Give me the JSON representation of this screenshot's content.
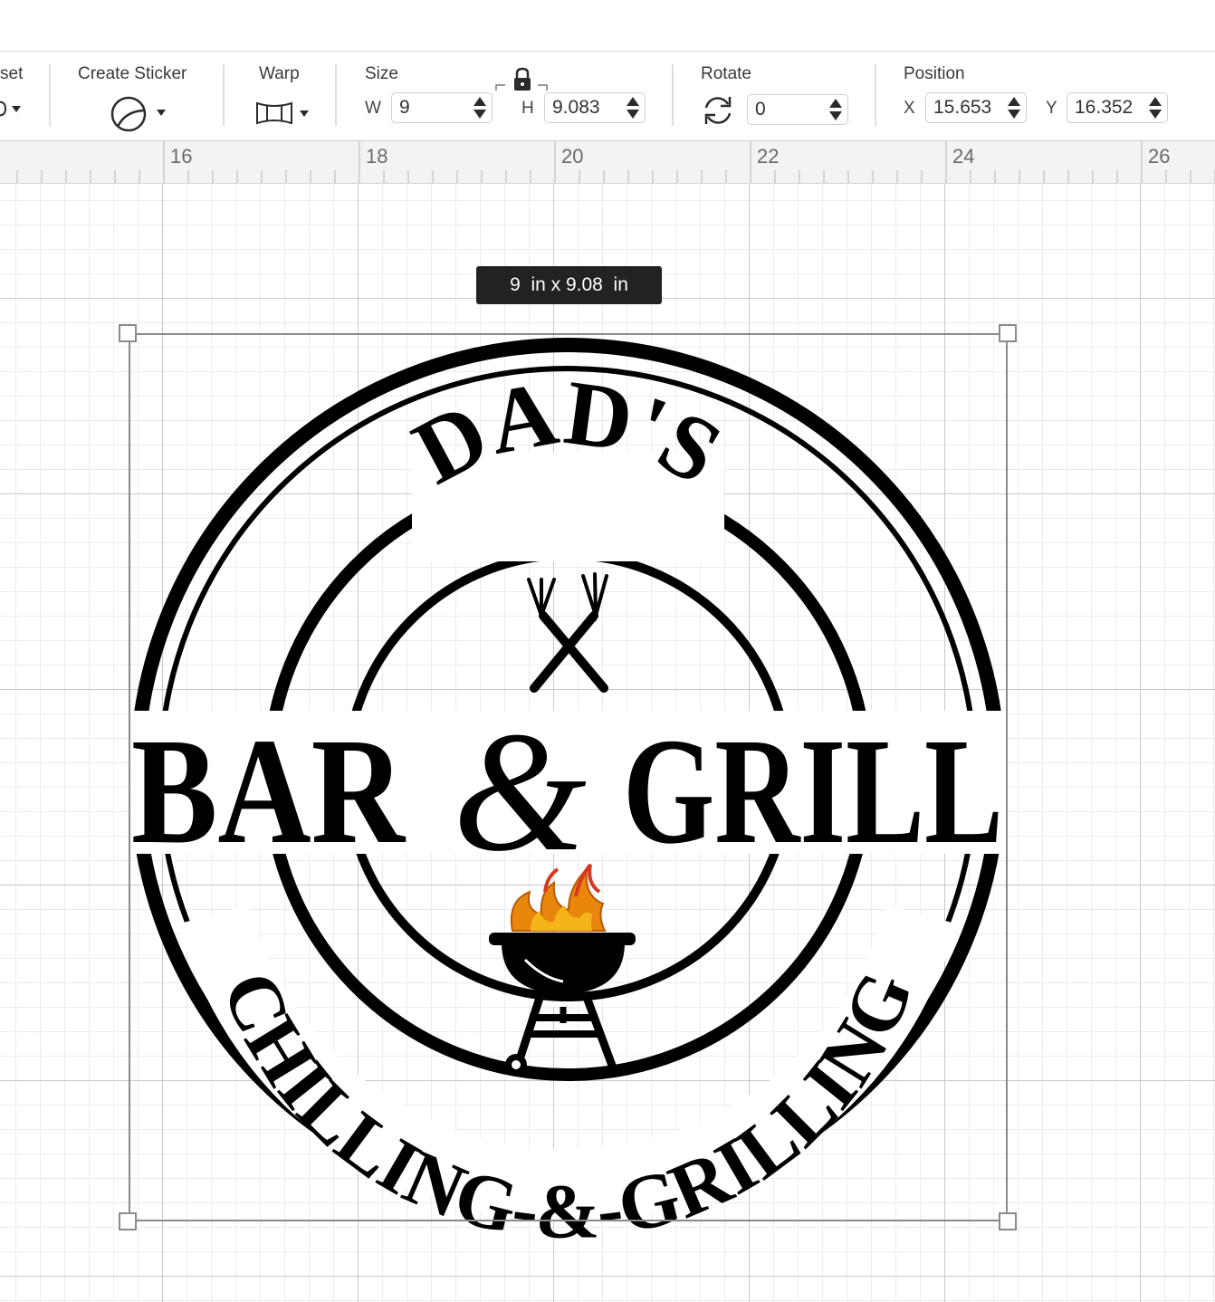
{
  "toolbar": {
    "offset_label": "set",
    "create_sticker_label": "Create Sticker",
    "warp_label": "Warp",
    "size_label": "Size",
    "width_letter": "W",
    "width_value": "9",
    "height_letter": "H",
    "height_value": "9.083",
    "rotate_label": "Rotate",
    "rotate_value": "0",
    "position_label": "Position",
    "x_letter": "X",
    "x_value": "15.653",
    "y_letter": "Y",
    "y_value": "16.352",
    "icons": [
      "offset-icon",
      "sticker-icon",
      "warp-icon",
      "lock-icon",
      "rotate-icon",
      "stepper-icon"
    ]
  },
  "ruler": {
    "ticks": [
      "16",
      "18",
      "20",
      "22",
      "24",
      "26"
    ]
  },
  "canvas": {
    "size_tooltip": "9  in x 9.08  in"
  },
  "design": {
    "top_text": "DAD'S",
    "middle_left": "BAR",
    "ampersand": "&",
    "middle_right": "GRILL",
    "bottom_text": "CHILLING-&-GRILLING",
    "icons": [
      "crossed-forks-icon",
      "grill-icon",
      "flames-icon"
    ],
    "flame_colors": [
      "#e8870c",
      "#f4b41a",
      "#d43a1f"
    ]
  }
}
